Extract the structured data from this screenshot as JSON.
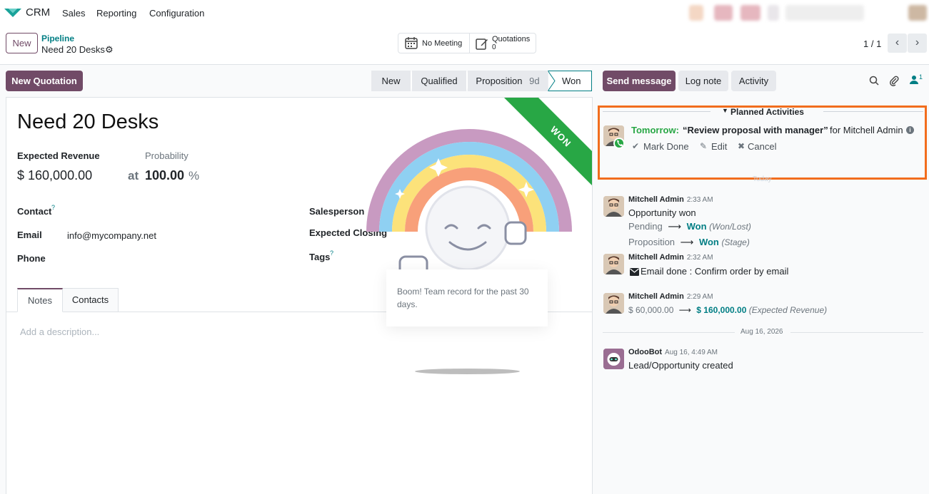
{
  "navbar": {
    "app_name": "CRM",
    "menu": [
      "Sales",
      "Reporting",
      "Configuration"
    ]
  },
  "control_panel": {
    "new_label": "New",
    "breadcrumb_parent": "Pipeline",
    "breadcrumb_current": "Need 20 Desks",
    "smart_buttons": {
      "meeting_label": "No Meeting",
      "quotations_label": "Quotations",
      "quotations_count": "0"
    },
    "pager": "1 / 1"
  },
  "form": {
    "new_quotation_label": "New Quotation",
    "stages": [
      {
        "label": "New",
        "extra": ""
      },
      {
        "label": "Qualified",
        "extra": ""
      },
      {
        "label": "Proposition",
        "extra": "9d"
      },
      {
        "label": "Won",
        "extra": ""
      }
    ],
    "current_stage": "Won",
    "ribbon": "WON",
    "title": "Need 20 Desks",
    "expected_revenue_label": "Expected Revenue",
    "probability_label": "Probability",
    "expected_revenue": "$ 160,000.00",
    "probability_prefix": "at",
    "probability": "100.00",
    "probability_suffix": "%",
    "contact_label": "Contact",
    "contact_help": "?",
    "email_label": "Email",
    "email": "info@mycompany.net",
    "phone_label": "Phone",
    "salesperson_label": "Salesperson",
    "expected_closing_label": "Expected Closing",
    "tags_label": "Tags",
    "tags_help": "?",
    "tabs": [
      "Notes",
      "Contacts"
    ],
    "description_placeholder": "Add a description..."
  },
  "effect": {
    "message": "Boom! Team record for the past 30 days."
  },
  "chatter": {
    "send_message_label": "Send message",
    "log_note_label": "Log note",
    "activity_label": "Activity",
    "followers_count": "1",
    "planned_activities_label": "Planned Activities",
    "activity": {
      "when": "Tomorrow:",
      "summary": "“Review proposal with manager”",
      "for_text": "for Mitchell Admin",
      "mark_done": "Mark Done",
      "edit": "Edit",
      "cancel": "Cancel"
    },
    "today_separator": "Today",
    "messages": [
      {
        "author": "Mitchell Admin",
        "date": "2:33 AM",
        "body": "Opportunity won",
        "tracking": [
          {
            "old": "Pending",
            "new": "Won",
            "field": "(Won/Lost)"
          },
          {
            "old": "Proposition",
            "new": "Won",
            "field": "(Stage)"
          }
        ]
      },
      {
        "author": "Mitchell Admin",
        "date": "2:32 AM",
        "body": "Email done : Confirm order by email"
      },
      {
        "author": "Mitchell Admin",
        "date": "2:29 AM",
        "tracking": [
          {
            "old": "$ 60,000.00",
            "new": "$ 160,000.00",
            "field": "(Expected Revenue)"
          }
        ]
      }
    ],
    "date_separator": "Aug 16, 2026",
    "bot_message": {
      "author": "OdooBot",
      "date": "Aug 16, 4:49 AM",
      "body": "Lead/Opportunity created"
    }
  },
  "colors": {
    "brand": "#714b67",
    "link": "#017e84",
    "success": "#28a745",
    "highlight": "#f26d1d"
  }
}
